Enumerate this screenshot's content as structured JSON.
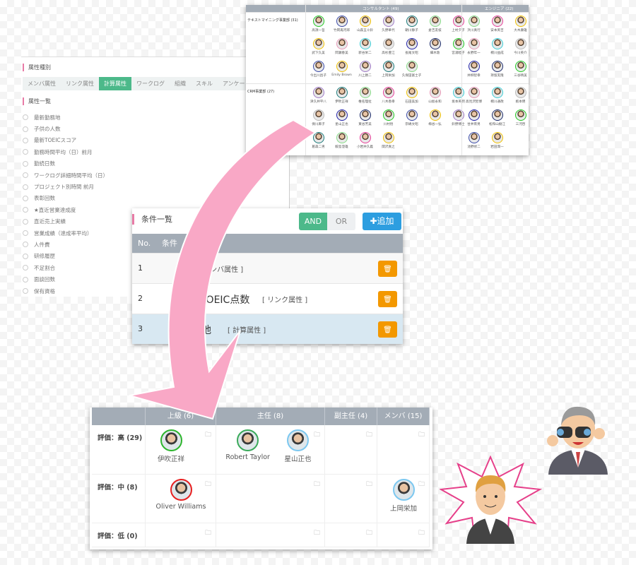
{
  "colors": {
    "accent_green": "#4cb98a",
    "accent_blue": "#2d9ee0",
    "delete_orange": "#f39800",
    "header_gray": "#a3acb6",
    "section_pink": "#e87ba6",
    "arrow_pink": "#f9a8c6"
  },
  "attribute_panel": {
    "type_heading": "属性種別",
    "tabs": [
      {
        "label": "メンバ属性",
        "active": false
      },
      {
        "label": "リンク属性",
        "active": false
      },
      {
        "label": "計算属性",
        "active": true
      },
      {
        "label": "ワークログ",
        "active": false
      },
      {
        "label": "組織",
        "active": false
      },
      {
        "label": "スキル",
        "active": false
      },
      {
        "label": "アンケート",
        "active": false
      }
    ],
    "list_heading": "属性一覧",
    "items": [
      "最新勤務地",
      "子供の人数",
      "最新TOEICスコア",
      "勤務時間平均（日）前月",
      "勤続日数",
      "ワークログ詳細時間平均（日）",
      "プロジェクト別時間 前月",
      "表彰回数",
      "★直近営業達成度",
      "直近売上実績",
      "営業成績（達成率平均）",
      "人件費",
      "研修履歴",
      "不足割合",
      "面談回数",
      "保有資格"
    ]
  },
  "org_panel": {
    "columns": [
      {
        "label": "コンサルタント (49)"
      },
      {
        "label": "エンジニア (22)"
      }
    ],
    "rows": [
      {
        "label": "テキストマイニング事業部 (31)",
        "consultants": [
          "高須一哲",
          "竹岡再河郎",
          "山森五十鈴",
          "久野華代",
          "朝川静子",
          "倉吉友枝",
          "上村夕子",
          "武下久美",
          "岡瀬春美",
          "新谷栄二",
          "高杉豊江",
          "長尾文昭",
          "細木敦",
          "宮浦睦子",
          "今出川昌子",
          "Emily Brown",
          "川上勝二",
          "上岡栄加",
          "久保田富士子"
        ],
        "engineers": [
          "浜川真行",
          "安本英吉",
          "大木康雄",
          "永野年一",
          "桐川益成",
          "今川英介",
          "井柳智幸",
          "持留実隆",
          "三谷晴美"
        ]
      },
      {
        "label": "CRM事業部 (27)",
        "consultants": [
          "津久井平八",
          "伊吹正祥",
          "椎名理拉",
          "八木香幸",
          "石田美加",
          "山坂永和",
          "坂本英明",
          "保川麻子",
          "星山正也",
          "東谷芳美",
          "川村悟",
          "宗嶋文昭",
          "梅谷一弘",
          "鈴野博士",
          "葛森二男",
          "鮫島澄雄",
          "小岩井久義",
          "関沢真之"
        ],
        "engineers": [
          "高見沢智博",
          "桐川通政",
          "栃本明",
          "甘井育男",
          "松和山樹江",
          "三河啓",
          "池野修二",
          "岩田潤一"
        ]
      }
    ]
  },
  "conditions_panel": {
    "title": "条件一覧",
    "and_label": "AND",
    "or_label": "OR",
    "selected_logic": "AND",
    "add_label": "✚追加",
    "header": {
      "no": "No.",
      "condition": "条件"
    },
    "rows": [
      {
        "no": "1",
        "name": "",
        "type": "[ メンバ属性 ]"
      },
      {
        "no": "2",
        "name": "TOEIC点数",
        "type": "[ リンク属性 ]"
      },
      {
        "no": "3",
        "name": "地",
        "type": "[ 計算属性 ]"
      }
    ],
    "delete_icon": "trash-icon"
  },
  "talent_grid": {
    "columns": [
      "上級 (6)",
      "主任 (8)",
      "副主任 (4)",
      "メンバ (15)"
    ],
    "rows": [
      {
        "label": "評価：高 (29)",
        "cells": [
          [
            {
              "name": "伊吹正祥",
              "ring": "#2db52d"
            }
          ],
          [
            {
              "name": "Robert Taylor",
              "ring": "#3aaa5a"
            },
            {
              "name": "星山正也",
              "ring": "#7cc8f0"
            }
          ],
          [],
          []
        ]
      },
      {
        "label": "評価：中 (8)",
        "cells": [
          [
            {
              "name": "Oliver Williams",
              "ring": "#e82020"
            }
          ],
          [],
          [],
          [
            {
              "name": "上岡栄加",
              "ring": "#7cc8f0"
            }
          ]
        ]
      },
      {
        "label": "評価：低 (0)",
        "cells": [
          [],
          [],
          [],
          []
        ]
      }
    ],
    "folder_icon": "folder-icon"
  }
}
